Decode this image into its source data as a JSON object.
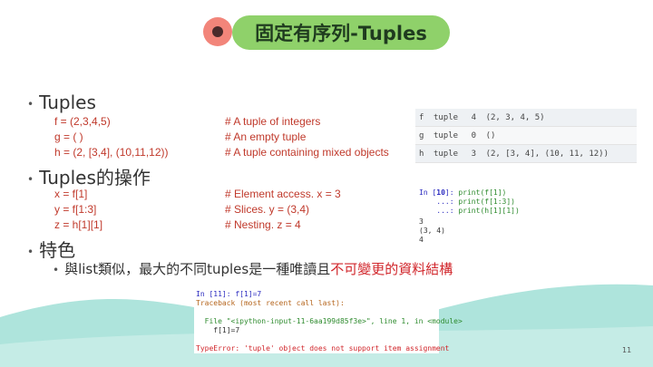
{
  "title": "固定有序列-Tuples",
  "bullets": {
    "tuples": "Tuples",
    "operations": "Tuples的操作",
    "features": "特色"
  },
  "def_code": [
    {
      "code": "f = (2,3,4,5)",
      "comment": "# A tuple of integers"
    },
    {
      "code": "g = ( )",
      "comment": "# An empty tuple"
    },
    {
      "code": "h = (2, [3,4], (10,11,12))",
      "comment": "# A tuple containing mixed objects"
    }
  ],
  "op_code": [
    {
      "code": "x = f[1]",
      "comment": "# Element access. x = 3"
    },
    {
      "code": "y = f[1:3]",
      "comment": "# Slices. y = (3,4)"
    },
    {
      "code": "z = h[1][1]",
      "comment": "# Nesting. z = 4"
    }
  ],
  "feature_text": {
    "normal": "與list類似，最大的不同tuples是一種唯讀且",
    "highlight": "不可變更的資料結構"
  },
  "variables": [
    {
      "name": "f",
      "type": "tuple",
      "size": "4",
      "value": "(2, 3, 4, 5)"
    },
    {
      "name": "g",
      "type": "tuple",
      "size": "0",
      "value": "()"
    },
    {
      "name": "h",
      "type": "tuple",
      "size": "3",
      "value": "(2, [3, 4], (10, 11, 12))"
    }
  ],
  "console_in": {
    "prompt": "In [",
    "number": "10",
    "prompt_end": "]: ",
    "lines": [
      "print(f[1])",
      "print(f[1:3])",
      "print(h[1][1])"
    ],
    "cont": "...: "
  },
  "console_out": [
    "3",
    "(3, 4)",
    "4"
  ],
  "error": {
    "in_line": "In [11]: f[1]=7",
    "traceback": "Traceback (most recent call last):",
    "file_line": "  File \"<ipython-input-11-6aa199d85f3e>\", line 1, in <module>",
    "code_line": "    f[1]=7",
    "type_error": "TypeError: 'tuple' object does not support item assignment"
  },
  "page_number": "11",
  "colors": {
    "title_pill": "#8fd16a",
    "title_dot": "#f2857a",
    "code_red": "#c0392b",
    "highlight_red": "#d1262b",
    "wave": "#aee4dc"
  }
}
